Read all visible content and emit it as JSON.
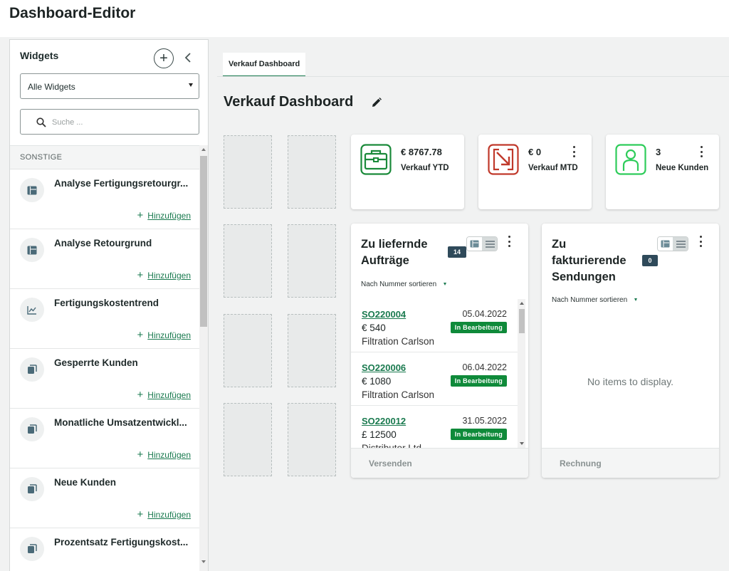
{
  "app": {
    "title": "Dashboard-Editor"
  },
  "sidebar": {
    "title": "Widgets",
    "filter_value": "Alle Widgets",
    "search_placeholder": "Suche ...",
    "section": "SONSTIGE",
    "add_label": "Hinzufügen",
    "items": [
      {
        "name": "Analyse Fertigungsretourgr...",
        "icon": "table-icon"
      },
      {
        "name": "Analyse Retourgrund",
        "icon": "table-icon"
      },
      {
        "name": "Fertigungskostentrend",
        "icon": "line-chart-icon"
      },
      {
        "name": "Gesperrte Kunden",
        "icon": "stack-icon"
      },
      {
        "name": "Monatliche Umsatzentwickl...",
        "icon": "stack-icon"
      },
      {
        "name": "Neue Kunden",
        "icon": "stack-icon"
      },
      {
        "name": "Prozentsatz Fertigungskost...",
        "icon": "stack-icon"
      }
    ]
  },
  "tabs": [
    {
      "label": "Verkauf Dashboard",
      "active": true
    }
  ],
  "dashboard": {
    "title": "Verkauf Dashboard",
    "kpis": [
      {
        "value": "€ 8767.78",
        "label": "Verkauf YTD",
        "icon": "briefcase-icon",
        "color": "#1a8a3a"
      },
      {
        "value": "€ 0",
        "label": "Verkauf MTD",
        "icon": "sales-down-icon",
        "color": "#c0392b"
      },
      {
        "value": "3",
        "label": "Neue Kunden",
        "icon": "person-icon",
        "color": "#2ecc5a"
      }
    ],
    "orders_card": {
      "title_line1": "Zu liefernde",
      "title_line2": "Aufträge",
      "count": "14",
      "sort": "Nach Nummer sortieren",
      "footer": "Versenden",
      "orders": [
        {
          "number": "SO220004",
          "date": "05.04.2022",
          "amount": "€ 540",
          "customer": "Filtration Carlson",
          "status": "In Bearbeitung"
        },
        {
          "number": "SO220006",
          "date": "06.04.2022",
          "amount": "€ 1080",
          "customer": "Filtration Carlson",
          "status": "In Bearbeitung"
        },
        {
          "number": "SO220012",
          "date": "31.05.2022",
          "amount": "£ 12500",
          "customer": "Distributor Ltd",
          "status": "In Bearbeitung"
        }
      ]
    },
    "shipments_card": {
      "title_line1": "Zu",
      "title_line2": "fakturierende",
      "title_line3": "Sendungen",
      "count": "0",
      "sort": "Nach Nummer sortieren",
      "empty": "No items to display.",
      "footer": "Rechnung"
    }
  }
}
